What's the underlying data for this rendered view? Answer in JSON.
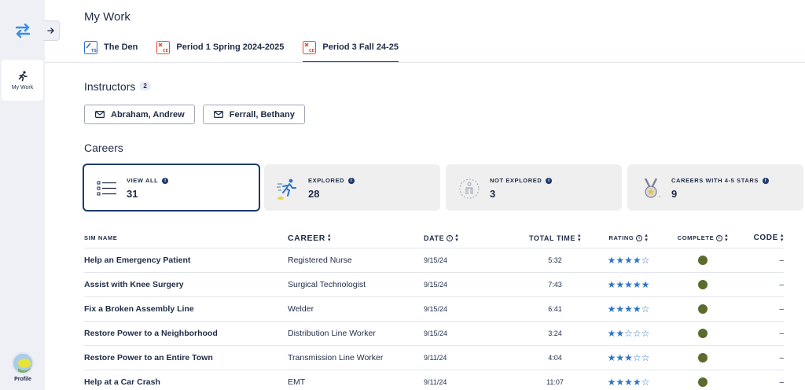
{
  "sidebar": {
    "nav_label": "My Work",
    "profile_label": "Profile"
  },
  "header": {
    "title": "My Work",
    "tabs": [
      {
        "label": "The Den",
        "badge": "TS",
        "color": "#2d6cc0",
        "active": false
      },
      {
        "label": "Period 1 Spring 2024-2025",
        "badge": "CE",
        "color": "#e2492f",
        "active": false
      },
      {
        "label": "Period 3 Fall 24-25",
        "badge": "CE",
        "color": "#e2492f",
        "active": true
      }
    ]
  },
  "instructors": {
    "title": "Instructors",
    "count": "2",
    "items": [
      "Abraham, Andrew",
      "Ferrall, Bethany"
    ]
  },
  "careers": {
    "title": "Careers",
    "cards": [
      {
        "label": "VIEW ALL",
        "value": "31",
        "icon": "list-icon"
      },
      {
        "label": "EXPLORED",
        "value": "28",
        "icon": "running-person-icon"
      },
      {
        "label": "NOT EXPLORED",
        "value": "3",
        "icon": "dashed-person-icon"
      },
      {
        "label": "CAREERS WITH 4-5 STARS",
        "value": "9",
        "icon": "medal-icon"
      }
    ]
  },
  "table": {
    "headers": {
      "sim": "SIM NAME",
      "career": "CAREER",
      "date": "DATE",
      "time": "TOTAL TIME",
      "rating": "RATING",
      "complete": "COMPLETE",
      "code": "CODE"
    },
    "rows": [
      {
        "sim": "Help an Emergency Patient",
        "career": "Registered Nurse",
        "date": "9/15/24",
        "time": "5:32",
        "rating": 4,
        "complete": true,
        "code": "–"
      },
      {
        "sim": "Assist with Knee Surgery",
        "career": "Surgical Technologist",
        "date": "9/15/24",
        "time": "7:43",
        "rating": 5,
        "complete": true,
        "code": "–"
      },
      {
        "sim": "Fix a Broken Assembly Line",
        "career": "Welder",
        "date": "9/15/24",
        "time": "6:41",
        "rating": 4,
        "complete": true,
        "code": "–"
      },
      {
        "sim": "Restore Power to a Neighborhood",
        "career": "Distribution Line Worker",
        "date": "9/15/24",
        "time": "3:24",
        "rating": 2,
        "complete": true,
        "code": "–"
      },
      {
        "sim": "Restore Power to an Entire Town",
        "career": "Transmission Line Worker",
        "date": "9/11/24",
        "time": "4:04",
        "rating": 3,
        "complete": true,
        "code": "–"
      },
      {
        "sim": "Help at a Car Crash",
        "career": "EMT",
        "date": "9/11/24",
        "time": "11:07",
        "rating": 4,
        "complete": true,
        "code": "–"
      }
    ]
  },
  "colors": {
    "navy": "#1f2b46",
    "star": "#2f74c5",
    "complete": "#5b6b2e",
    "swap_icon": "#3a8ee6"
  }
}
